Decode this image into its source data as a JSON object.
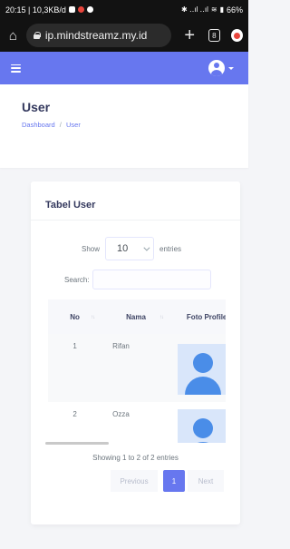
{
  "status_bar": {
    "left_text": "20:15 | 10,3KB/d",
    "battery": "66%"
  },
  "browser": {
    "url": "ip.mindstreamz.my.id",
    "tab_count": "8",
    "new_tab_label": "+"
  },
  "navbar": {
    "accent_color": "#6777ef",
    "menu_icon": "hamburger-icon",
    "user_icon": "user-avatar-icon"
  },
  "page": {
    "title": "User",
    "breadcrumb": [
      "Dashboard",
      "/",
      "User"
    ]
  },
  "card": {
    "title": "Tabel User",
    "length": {
      "show_label": "Show",
      "value": "10",
      "entries_label": "entries"
    },
    "search": {
      "label": "Search:",
      "placeholder": ""
    },
    "table": {
      "headers": [
        "No",
        "Nama",
        "Foto Profile"
      ],
      "rows": [
        {
          "no": "1",
          "nama": "Rifan",
          "foto": "profile-placeholder-icon"
        },
        {
          "no": "2",
          "nama": "Ozza",
          "foto": "profile-placeholder-icon"
        }
      ]
    },
    "info": "Showing 1 to 2 of 2 entries",
    "pagination": {
      "previous": "Previous",
      "current": "1",
      "next": "Next"
    }
  }
}
